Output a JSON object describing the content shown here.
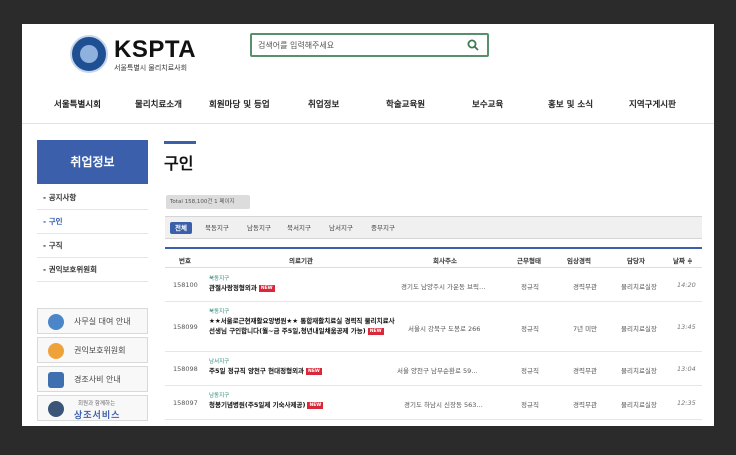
{
  "header": {
    "logo_main": "KSPTA",
    "logo_sub": "서울특별시 물리치료사회",
    "search_placeholder": "검색어를 입력해주세요"
  },
  "nav": [
    "서울특별시회",
    "물리치료소개",
    "회원마당 및 등업",
    "취업정보",
    "학술교육원",
    "보수교육",
    "홍보 및 소식",
    "지역구게시판"
  ],
  "sidebar": {
    "title": "취업정보",
    "items": [
      {
        "label": "- 공지사항",
        "active": false
      },
      {
        "label": "- 구인",
        "active": true
      },
      {
        "label": "- 구직",
        "active": false
      },
      {
        "label": "- 권익보호위원회",
        "active": false
      }
    ],
    "quick_links": [
      {
        "label": "사무실 대여 안내",
        "icon": "monitor-icon",
        "color": "#4a86c8"
      },
      {
        "label": "권익보호위원회",
        "icon": "people-icon",
        "color": "#f0a23a"
      },
      {
        "label": "경조사비 안내",
        "icon": "document-icon",
        "color": "#3f6fb0"
      },
      {
        "small": "회원과 함께하는",
        "label": "상조서비스",
        "icon": "person-icon",
        "color": "#3a5578"
      }
    ]
  },
  "main": {
    "title": "구인",
    "total": "Total 158,100건 1 페이지",
    "tabs": [
      "전체",
      "북동지구",
      "남동지구",
      "북서지구",
      "남서지구",
      "중부지구"
    ],
    "columns": [
      "번호",
      "의료기관",
      "회사주소",
      "근무형태",
      "임상경력",
      "담당자",
      "날짜 ≑"
    ],
    "new_label": "NEW",
    "rows": [
      {
        "no": "158100",
        "region": "북동지구",
        "company": "관절사랑정형외과",
        "address": "경기도 남양주시 가운동 브릭…",
        "type": "정규직",
        "career": "경력무관",
        "manager": "물리치료실장",
        "date": "14:20"
      },
      {
        "no": "158099",
        "region": "북동지구",
        "company": "★★서울로근현재활요양병원★★ 통합재활치료실 경력직 물리치료사 선생님 구인합니다(월~금 주5일,청년내일채움공제 가능)",
        "address": "서울시 강북구 도봉로 266",
        "type": "정규직",
        "career": "7년 미만",
        "manager": "물리치료실장",
        "date": "13:45"
      },
      {
        "no": "158098",
        "region": "남서지구",
        "company": "주5일 정규직 양천구 현대정형외과",
        "address": "서울 양천구 남부순환로 59…",
        "type": "정규직",
        "career": "경력무관",
        "manager": "물리치료실장",
        "date": "13:04"
      },
      {
        "no": "158097",
        "region": "남동지구",
        "company": "청봉기념병원(주5일제 기숙사제공)",
        "address": "경기도 하남시 신장동 563…",
        "type": "정규직",
        "career": "경력무관",
        "manager": "물리치료실장",
        "date": "12:35"
      }
    ]
  },
  "colors": {
    "brand": "#3b5fab",
    "search_border": "#57906a",
    "region": "#2a8a78",
    "new_badge": "#d9283a"
  }
}
